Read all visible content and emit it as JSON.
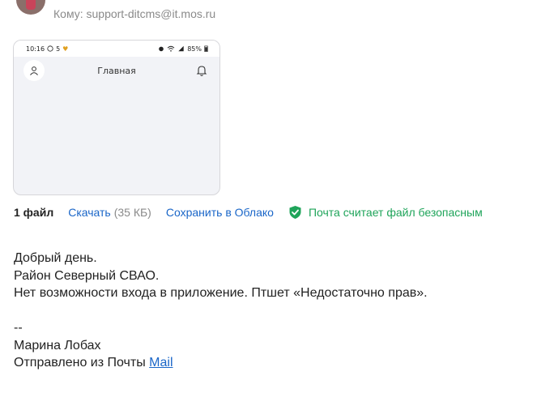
{
  "header": {
    "to_line": "Кому: support-ditcms@it.mos.ru"
  },
  "attachment_preview": {
    "status_time": "10:16",
    "status_extra": "5",
    "battery": "85%",
    "app_title": "Главная"
  },
  "file_bar": {
    "count": "1 файл",
    "download": "Скачать",
    "size": "(35 КБ)",
    "save_cloud": "Сохранить в Облако",
    "safe_message": "Почта считает файл безопасным"
  },
  "message": {
    "greeting": "Добрый день.",
    "district": "Район Северный СВАО.",
    "problem": "Нет возможности входа в приложение. Птшет «Недостаточно прав».",
    "separator": "--",
    "signature_name": "Марина Лобах",
    "sent_from_prefix": "Отправлено из Почты ",
    "sent_from_link": "Mail"
  },
  "colors": {
    "link": "#1a66c8",
    "safe": "#1fa45a",
    "muted": "#8a8a8a"
  }
}
